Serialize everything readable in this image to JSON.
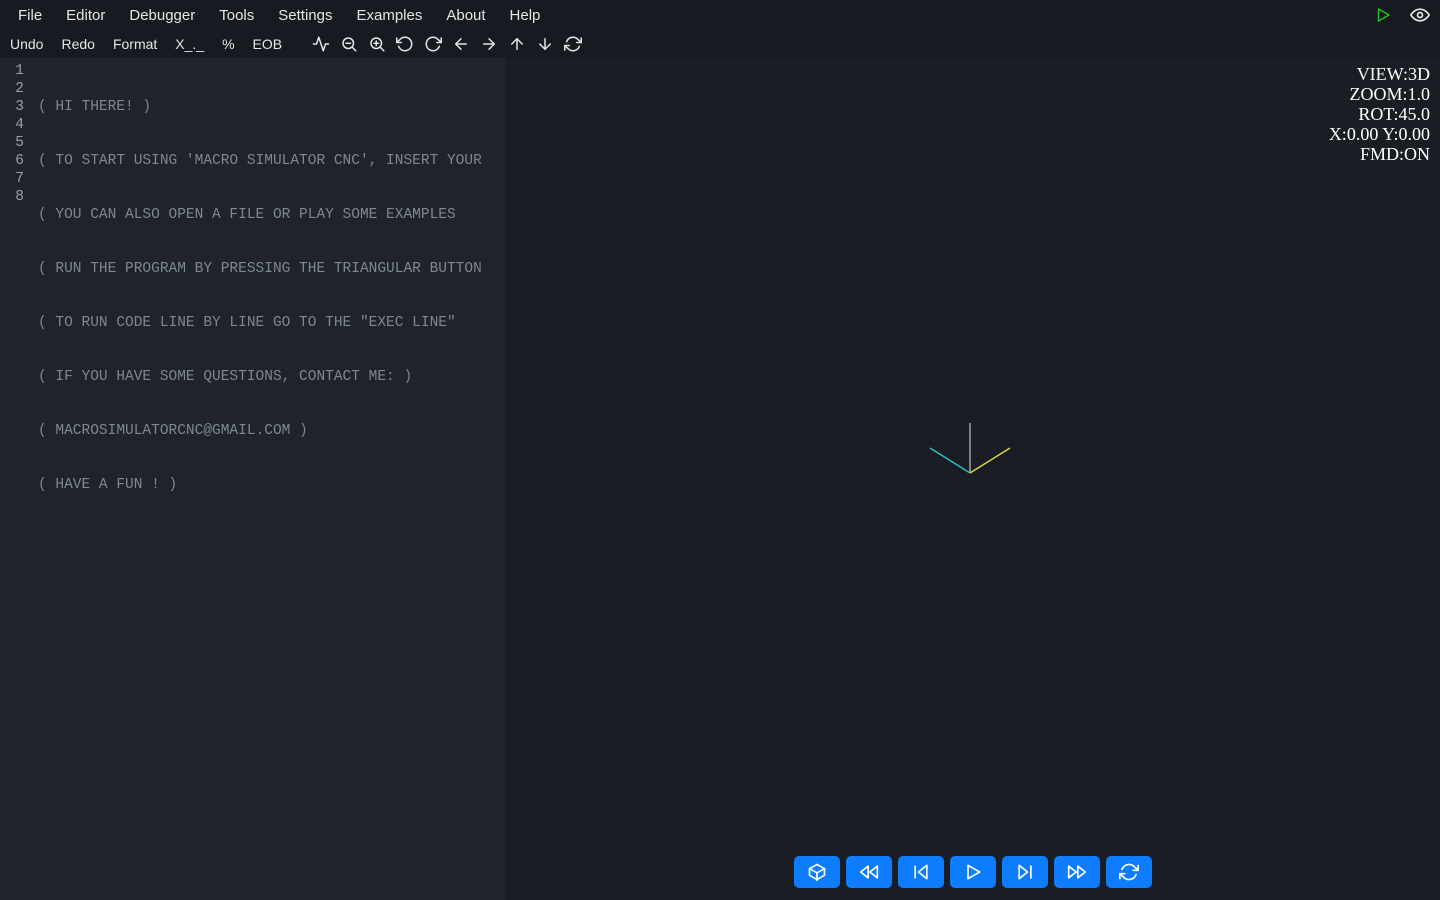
{
  "menubar": {
    "items": [
      "File",
      "Editor",
      "Debugger",
      "Tools",
      "Settings",
      "Examples",
      "About",
      "Help"
    ]
  },
  "toolbar": {
    "undo": "Undo",
    "redo": "Redo",
    "format": "Format",
    "xdot": "X_._",
    "percent": "%",
    "eob": "EOB"
  },
  "editor": {
    "lines": [
      "( HI THERE! )",
      "( TO START USING 'MACRO SIMULATOR CNC', INSERT YOUR",
      "( YOU CAN ALSO OPEN A FILE OR PLAY SOME EXAMPLES ",
      "( RUN THE PROGRAM BY PRESSING THE TRIANGULAR BUTTON",
      "( TO RUN CODE LINE BY LINE GO TO THE \"EXEC LINE\" ",
      "( IF YOU HAVE SOME QUESTIONS, CONTACT ME: )",
      "( MACROSIMULATORCNC@GMAIL.COM )",
      "( HAVE A FUN ! )"
    ]
  },
  "hud": {
    "view": "VIEW:3D",
    "zoom": "ZOOM:1.0",
    "rot": "ROT:45.0",
    "xy": "X:0.00 Y:0.00",
    "fmd": "FMD:ON"
  },
  "colors": {
    "accent_green": "#25c225",
    "accent_blue": "#0d7cff",
    "axis_cyan": "#27c3c7",
    "axis_yellow": "#d6d63e",
    "axis_gray": "#9ea3ad"
  }
}
